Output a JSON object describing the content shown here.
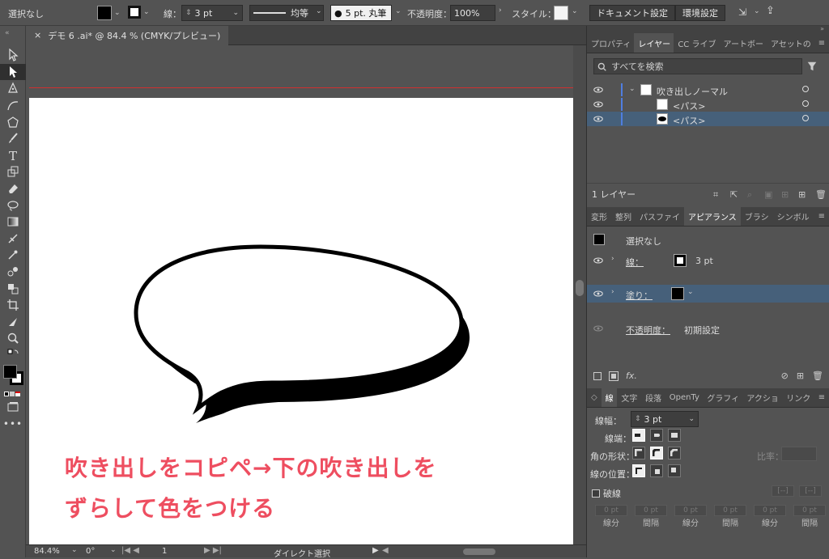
{
  "control_bar": {
    "selection_label": "選択なし",
    "stroke_label": "線：",
    "stroke_weight": "3 pt",
    "profile_label": "均等",
    "brush_label": "5 pt. 丸筆",
    "opacity_label": "不透明度：",
    "opacity_value": "100%",
    "style_label": "スタイル：",
    "doc_settings_button": "ドキュメント設定",
    "preferences_button": "環境設定"
  },
  "document": {
    "tab_title": "デモ 6 .ai* @ 84.4 % (CMYK/プレビュー)",
    "close_glyph": "×"
  },
  "overlay_text": {
    "line1": "吹き出しをコピペ→下の吹き出しを",
    "line2": "ずらして色をつける"
  },
  "status_bar": {
    "zoom": "84.4%",
    "rotation": "0°",
    "artboard_number": "1",
    "current_tool": "ダイレクト選択"
  },
  "layers_panel": {
    "tabs": [
      "プロパティ",
      "レイヤー",
      "CC ライブ",
      "アートボー",
      "アセットの"
    ],
    "active_tab": 1,
    "search_placeholder": "すべてを検索",
    "rows": [
      {
        "name": "吹き出しノーマル",
        "indent": 0
      },
      {
        "name": "<パス>",
        "indent": 1
      },
      {
        "name": "<パス>",
        "indent": 1
      }
    ],
    "footer_label": "1 レイヤー"
  },
  "appearance_panel": {
    "tabs": [
      "変形",
      "整列",
      "パスファイ",
      "アピアランス",
      "ブラシ",
      "シンボル"
    ],
    "active_tab": 3,
    "object_label": "選択なし",
    "stroke_label": "線：",
    "stroke_value": "3 pt",
    "fill_label": "塗り：",
    "opacity_label": "不透明度：",
    "opacity_value": "初期設定",
    "fx_label": "fx."
  },
  "stroke_panel": {
    "tabs": [
      "線",
      "文字",
      "段落",
      "OpenTy",
      "グラフィ",
      "アクショ",
      "リンク"
    ],
    "active_tab": 0,
    "weight_label": "線幅：",
    "weight_value": "3 pt",
    "cap_label": "線端：",
    "corner_label": "角の形状：",
    "limit_label": "比率：",
    "align_label": "線の位置：",
    "dashed_label": "破線",
    "dash_fields": [
      {
        "value": "0 pt",
        "label": "線分"
      },
      {
        "value": "0 pt",
        "label": "間隔"
      },
      {
        "value": "0 pt",
        "label": "線分"
      },
      {
        "value": "0 pt",
        "label": "間隔"
      },
      {
        "value": "0 pt",
        "label": "線分"
      },
      {
        "value": "0 pt",
        "label": "間隔"
      }
    ]
  },
  "colors": {
    "accent_selection": "#46607a",
    "overlay_text": "#ee4e60",
    "guide_red": "#d03030"
  }
}
